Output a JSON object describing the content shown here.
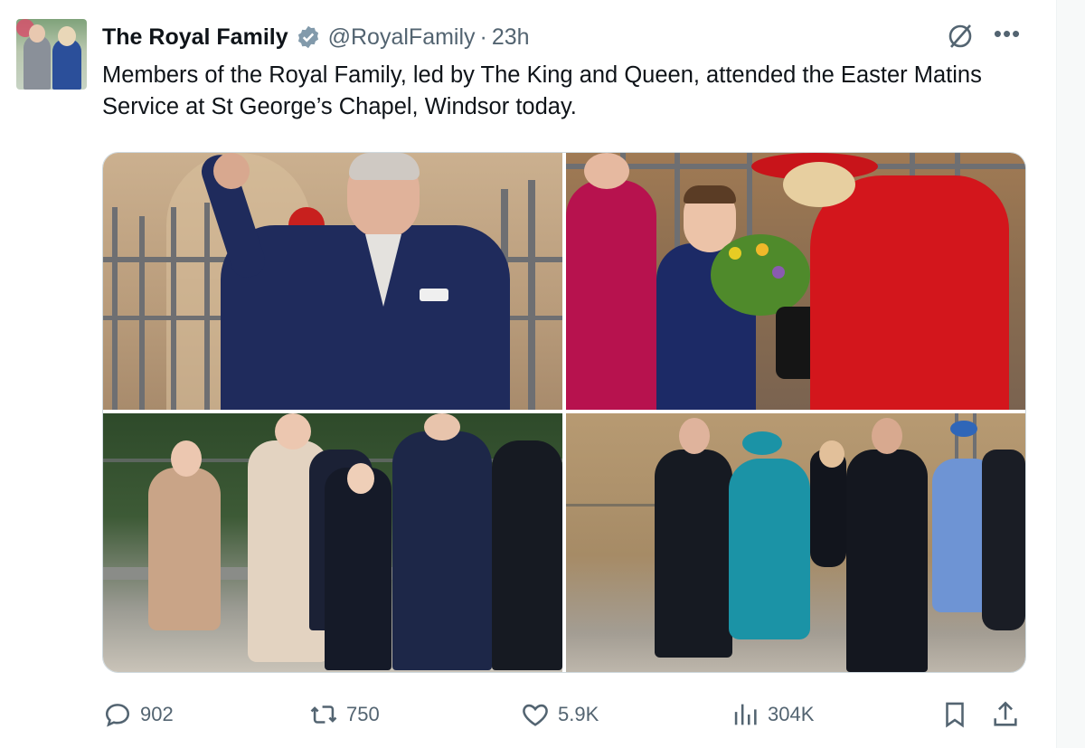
{
  "tweet": {
    "author_name": "The Royal Family",
    "handle": "@RoyalFamily",
    "separator": "·",
    "time": "23h",
    "text": "Members of the Royal Family, led by The King and Queen, attended the Easter Matins Service at St George’s Chapel, Windsor today.",
    "verified_color": "#829aab"
  },
  "actions": {
    "replies": "902",
    "reposts": "750",
    "likes": "5.9K",
    "views": "304K"
  },
  "icons": {
    "grok": "grok-icon",
    "more": "more-icon",
    "reply": "reply-icon",
    "repost": "repost-icon",
    "like": "heart-icon",
    "views": "views-icon",
    "bookmark": "bookmark-icon",
    "share": "share-icon"
  },
  "colors": {
    "text": "#0f1419",
    "secondary": "#536471",
    "border": "#cfd9de"
  }
}
